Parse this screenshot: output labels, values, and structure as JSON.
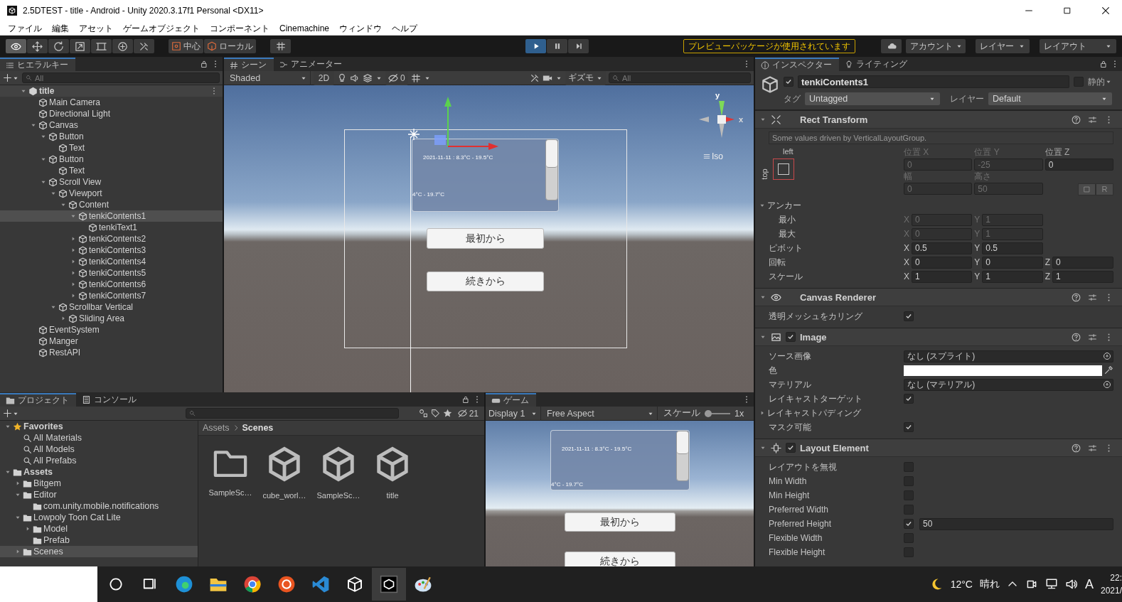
{
  "window": {
    "title": "2.5DTEST - title - Android - Unity 2020.3.17f1 Personal <DX11>"
  },
  "menu": [
    "ファイル",
    "編集",
    "アセット",
    "ゲームオブジェクト",
    "コンポーネント",
    "Cinemachine",
    "ウィンドウ",
    "ヘルプ"
  ],
  "toolbar": {
    "tools": [
      {
        "kind": "view",
        "selected": true
      },
      {
        "kind": "move",
        "selected": false
      },
      {
        "kind": "rotate",
        "selected": false
      },
      {
        "kind": "scale",
        "selected": false
      },
      {
        "kind": "rect",
        "selected": false
      },
      {
        "kind": "transform",
        "selected": false
      },
      {
        "kind": "custom",
        "selected": false
      }
    ],
    "pivot": "中心",
    "space": "ローカル",
    "playback": [
      {
        "kind": "play",
        "selected": true
      },
      {
        "kind": "pause",
        "selected": false
      },
      {
        "kind": "step",
        "selected": false
      }
    ],
    "notice": "プレビューパッケージが使用されています",
    "account": "アカウント",
    "layers": "レイヤー",
    "layout": "レイアウト"
  },
  "hierarchy": {
    "tab": "ヒエラルキー",
    "search_placeholder": "All",
    "tree": [
      {
        "kind": "scene",
        "label": "title",
        "selected": false,
        "expanded": true,
        "children": [
          {
            "label": "Main Camera",
            "selected": false
          },
          {
            "label": "Directional Light",
            "selected": false
          },
          {
            "label": "Canvas",
            "selected": false,
            "expanded": true,
            "children": [
              {
                "label": "Button",
                "selected": false,
                "expanded": true,
                "children": [
                  {
                    "label": "Text",
                    "selected": false
                  }
                ]
              },
              {
                "label": "Button",
                "selected": false,
                "expanded": true,
                "children": [
                  {
                    "label": "Text",
                    "selected": false
                  }
                ]
              },
              {
                "label": "Scroll View",
                "selected": false,
                "expanded": true,
                "children": [
                  {
                    "label": "Viewport",
                    "selected": false,
                    "expanded": true,
                    "children": [
                      {
                        "label": "Content",
                        "selected": false,
                        "expanded": true,
                        "children": [
                          {
                            "label": "tenkiContents1",
                            "selected": true,
                            "expanded": true,
                            "children": [
                              {
                                "label": "tenkiText1",
                                "selected": false
                              }
                            ]
                          },
                          {
                            "label": "tenkiContents2",
                            "selected": false,
                            "expanded": false
                          },
                          {
                            "label": "tenkiContents3",
                            "selected": false,
                            "expanded": false
                          },
                          {
                            "label": "tenkiContents4",
                            "selected": false,
                            "expanded": false
                          },
                          {
                            "label": "tenkiContents5",
                            "selected": false,
                            "expanded": false
                          },
                          {
                            "label": "tenkiContents6",
                            "selected": false,
                            "expanded": false
                          },
                          {
                            "label": "tenkiContents7",
                            "selected": false,
                            "expanded": false
                          }
                        ]
                      }
                    ]
                  },
                  {
                    "label": "Scrollbar Vertical",
                    "selected": false,
                    "expanded": true,
                    "children": [
                      {
                        "label": "Sliding Area",
                        "selected": false,
                        "expanded": false
                      }
                    ]
                  }
                ]
              }
            ]
          },
          {
            "label": "EventSystem",
            "selected": false
          },
          {
            "label": "Manger",
            "selected": false
          },
          {
            "label": "RestAPI",
            "selected": false
          }
        ]
      }
    ]
  },
  "scene": {
    "tabs": [
      {
        "kind": "scene",
        "label": "シーン",
        "selected": true
      },
      {
        "kind": "animator",
        "label": "アニメーター",
        "selected": false
      }
    ],
    "shading": "Shaded",
    "mode_2d": "2D",
    "hidden_count": "0",
    "gizmos": "ギズモ",
    "search_placeholder": "All",
    "panel_lines": [
      "2021-11-11 : 8.3°C - 19.5°C",
      "4°C - 19.7°C"
    ],
    "buttons": [
      "最初から",
      "続きから"
    ],
    "gizmo": {
      "y": "y",
      "x": "x",
      "projection": "Iso"
    }
  },
  "project": {
    "tabs": [
      {
        "kind": "project",
        "label": "プロジェクト",
        "selected": true
      },
      {
        "kind": "console",
        "label": "コンソール",
        "selected": false
      }
    ],
    "hidden_count": "21",
    "tree": [
      {
        "kind": "favorites",
        "label": "Favorites",
        "selected": false,
        "expanded": true,
        "children": [
          {
            "kind": "search",
            "label": "All Materials",
            "selected": false
          },
          {
            "kind": "search",
            "label": "All Models",
            "selected": false
          },
          {
            "kind": "search",
            "label": "All Prefabs",
            "selected": false
          }
        ]
      },
      {
        "kind": "root",
        "label": "Assets",
        "selected": false,
        "expanded": true,
        "children": [
          {
            "kind": "folder",
            "label": "Bitgem",
            "selected": false,
            "expanded": false
          },
          {
            "kind": "folder",
            "label": "Editor",
            "selected": false,
            "expanded": true,
            "children": [
              {
                "kind": "folder",
                "label": "com.unity.mobile.notifications",
                "selected": false
              }
            ]
          },
          {
            "kind": "folder",
            "label": "Lowpoly Toon Cat Lite",
            "selected": false,
            "expanded": true,
            "children": [
              {
                "kind": "folder",
                "label": "Model",
                "selected": false,
                "expanded": false
              },
              {
                "kind": "folder",
                "label": "Prefab",
                "selected": false
              }
            ]
          },
          {
            "kind": "folder",
            "label": "Scenes",
            "selected": true,
            "expanded": false
          }
        ]
      }
    ],
    "breadcrumb": [
      "Assets",
      "Scenes"
    ],
    "assets": [
      {
        "kind": "folder",
        "label": "SampleSc…"
      },
      {
        "kind": "scene",
        "label": "cube_worl…"
      },
      {
        "kind": "scene",
        "label": "SampleSc…"
      },
      {
        "kind": "scene",
        "label": "title"
      }
    ]
  },
  "game": {
    "tab": "ゲーム",
    "display": "Display 1",
    "aspect": "Free Aspect",
    "scale_label": "スケール",
    "scale": {
      "level": 0
    },
    "scale_value": "1x",
    "panel_lines": [
      "2021-11-11 : 8.3°C - 19.5°C",
      "4°C - 19.7°C"
    ],
    "buttons": [
      "最初から",
      "続きから"
    ]
  },
  "inspector": {
    "tabs": [
      {
        "kind": "inspector",
        "label": "インスペクター",
        "selected": true
      },
      {
        "kind": "lighting",
        "label": "ライティング",
        "selected": false
      }
    ],
    "object": {
      "active": true,
      "name": "tenkiContents1",
      "static": false,
      "static_label": "静的",
      "tag_label": "タグ",
      "tag": "Untagged",
      "layer_label": "レイヤー",
      "layer": "Default"
    },
    "components": [
      {
        "kind": "rect_transform",
        "title": "Rect Transform",
        "expanded": true,
        "note": "Some values driven by VerticalLayoutGroup.",
        "anchor_h": "left",
        "anchor_v": "top",
        "position": [
          {
            "header": "位置 X",
            "value": "0",
            "disabled": true
          },
          {
            "header": "位置 Y",
            "value": "-25",
            "disabled": true
          },
          {
            "header": "位置 Z",
            "value": "0",
            "disabled": false
          }
        ],
        "size": [
          {
            "header": "幅",
            "value": "0",
            "disabled": true
          },
          {
            "header": "高さ",
            "value": "50",
            "disabled": true
          }
        ],
        "raw_button": "R",
        "rows": [
          {
            "kind": "foldout",
            "label": "アンカー",
            "expanded": true,
            "children": [
              {
                "kind": "vector",
                "label": "最小",
                "disabled": true,
                "values": [
                  {
                    "axis": "X",
                    "value": "0"
                  },
                  {
                    "axis": "Y",
                    "value": "1"
                  }
                ]
              },
              {
                "kind": "vector",
                "label": "最大",
                "disabled": true,
                "values": [
                  {
                    "axis": "X",
                    "value": "0"
                  },
                  {
                    "axis": "Y",
                    "value": "1"
                  }
                ]
              }
            ]
          },
          {
            "kind": "vector",
            "label": "ピボット",
            "disabled": false,
            "values": [
              {
                "axis": "X",
                "value": "0.5"
              },
              {
                "axis": "Y",
                "value": "0.5"
              }
            ]
          },
          {
            "kind": "vector",
            "label": "回転",
            "disabled": false,
            "values": [
              {
                "axis": "X",
                "value": "0"
              },
              {
                "axis": "Y",
                "value": "0"
              },
              {
                "axis": "Z",
                "value": "0"
              }
            ]
          },
          {
            "kind": "vector",
            "label": "スケール",
            "disabled": false,
            "values": [
              {
                "axis": "X",
                "value": "1"
              },
              {
                "axis": "Y",
                "value": "1"
              },
              {
                "axis": "Z",
                "value": "1"
              }
            ]
          }
        ]
      },
      {
        "kind": "canvas_renderer",
        "title": "Canvas Renderer",
        "expanded": true,
        "rows": [
          {
            "kind": "checkbox",
            "label": "透明メッシュをカリング",
            "checked": true
          }
        ]
      },
      {
        "kind": "image",
        "title": "Image",
        "enabled": true,
        "expanded": true,
        "rows": [
          {
            "kind": "object",
            "label": "ソース画像",
            "value": "なし (スプライト)"
          },
          {
            "kind": "color",
            "label": "色",
            "color": "#ffffff"
          },
          {
            "kind": "object",
            "label": "マテリアル",
            "value": "なし (マテリアル)"
          },
          {
            "kind": "checkbox",
            "label": "レイキャストターゲット",
            "checked": true
          },
          {
            "kind": "foldout",
            "label": "レイキャストパディング",
            "expanded": false
          },
          {
            "kind": "checkbox",
            "label": "マスク可能",
            "checked": true
          }
        ]
      },
      {
        "kind": "layout_element",
        "title": "Layout Element",
        "enabled": true,
        "expanded": true,
        "rows": [
          {
            "kind": "checkbox",
            "label": "レイアウトを無視",
            "checked": false
          },
          {
            "kind": "checkbox",
            "label": "Min Width",
            "checked": false
          },
          {
            "kind": "checkbox",
            "label": "Min Height",
            "checked": false
          },
          {
            "kind": "checkbox",
            "label": "Preferred Width",
            "checked": false
          },
          {
            "kind": "checkbox",
            "label": "Preferred Height",
            "checked": true,
            "value": "50"
          },
          {
            "kind": "checkbox",
            "label": "Flexible Width",
            "checked": false
          },
          {
            "kind": "checkbox",
            "label": "Flexible Height",
            "checked": false
          }
        ]
      }
    ]
  },
  "taskbar": {
    "apps": [
      {
        "kind": "search",
        "selected": false
      },
      {
        "kind": "taskview",
        "selected": false
      },
      {
        "kind": "edge",
        "selected": false
      },
      {
        "kind": "explorer",
        "selected": false
      },
      {
        "kind": "chrome",
        "selected": false
      },
      {
        "kind": "ubuntu",
        "selected": false
      },
      {
        "kind": "vscode",
        "selected": false
      },
      {
        "kind": "hub",
        "selected": false
      },
      {
        "kind": "unity",
        "selected": true
      },
      {
        "kind": "paint",
        "selected": false
      }
    ],
    "temperature": "12°C",
    "weather": "晴れ",
    "ime": "A",
    "time": "22:",
    "date": "2021/"
  }
}
